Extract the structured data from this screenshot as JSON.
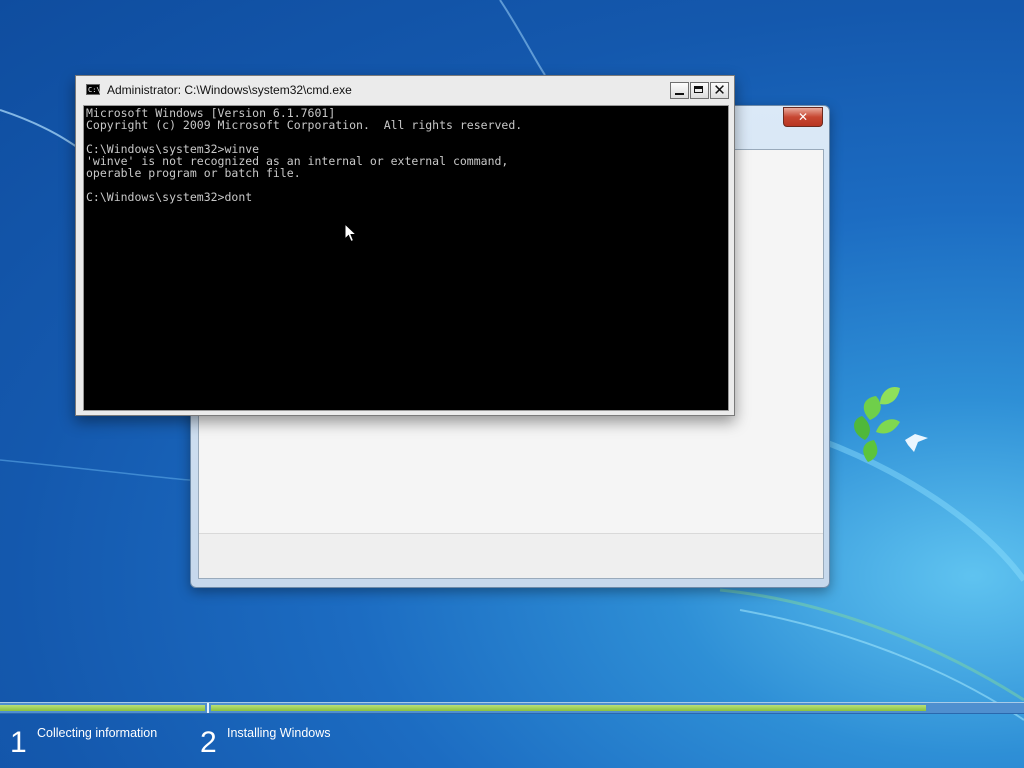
{
  "desktop": {
    "background_color": "#1a64bd",
    "logo": "windows-7-leaf-logo"
  },
  "cmd_window": {
    "title": "Administrator: C:\\Windows\\system32\\cmd.exe",
    "icon": "cmd-icon",
    "icon_label": "C:\\",
    "console_lines": [
      "Microsoft Windows [Version 6.1.7601]",
      "Copyright (c) 2009 Microsoft Corporation.  All rights reserved.",
      "",
      "C:\\Windows\\system32>winve",
      "'winve' is not recognized as an internal or external command,",
      "operable program or batch file.",
      "",
      "C:\\Windows\\system32>dont"
    ],
    "buttons": {
      "minimize": "minimize-icon",
      "maximize": "maximize-icon",
      "close": "close-icon",
      "close_glyph": "✕"
    },
    "console_bg": "#000000",
    "console_fg": "#c0c0c0"
  },
  "setup_window": {
    "close_glyph": "✕",
    "accent": "#c74732"
  },
  "progress": {
    "fill_fraction": 0.88,
    "accent": "#8cc23c",
    "steps": [
      {
        "number": "1",
        "label": "Collecting information"
      },
      {
        "number": "2",
        "label": "Installing Windows"
      }
    ]
  }
}
